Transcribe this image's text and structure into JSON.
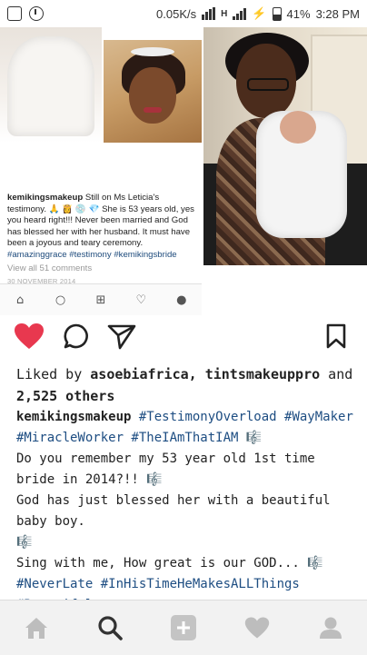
{
  "status_bar": {
    "speed": "0.05K/s",
    "network": "H",
    "battery": "41%",
    "time": "3:28 PM"
  },
  "embedded_post": {
    "username": "kemikingsmakeup",
    "text": " Still on Ms Leticia's testimony. 🙏 👸 💿 💎 She is 53 years old, yes you heard right!!! Never been married and God has blessed her with her husband. It must have been a joyous and teary ceremony. ",
    "hashtags": "#amazinggrace #testimony #kemikingsbride",
    "view_comments": "View all 51 comments",
    "date": "30 NOVEMBER 2014",
    "nav_icons": [
      "home-icon",
      "search-icon",
      "add-icon",
      "heart-icon",
      "profile-icon"
    ]
  },
  "post": {
    "liked_by_prefix": "Liked by ",
    "liked_by_users": "asoebiafrica, tintsmakeuppro",
    "liked_by_suffix": " and ",
    "liked_by_count": "2,525",
    "liked_by_end": " others",
    "caption_user": "kemikingsmakeup",
    "caption_tags_1": " #TestimonyOverload #WayMaker #MiracleWorker #TheIAmThatIAM",
    "caption_emoji_1": " 🎼",
    "line_2": "Do you remember my 53 year old 1st time bride in 2014?!! ",
    "emoji_2": "🎼",
    "line_3": "God has just blessed her with a beautiful baby boy.",
    "emoji_3": "🎼",
    "line_4": "Sing with me, How great is our GOD... ",
    "emoji_4": "🎼",
    "caption_tags_2": "#NeverLate #InHisTimeHeMakesALLThings #Beautiful"
  },
  "colors": {
    "heart": "#e8384f",
    "hashtag": "#1d4d82",
    "text": "#222222"
  },
  "bottom_nav": [
    "home-icon",
    "search-icon",
    "add-icon",
    "heart-icon",
    "profile-icon"
  ]
}
